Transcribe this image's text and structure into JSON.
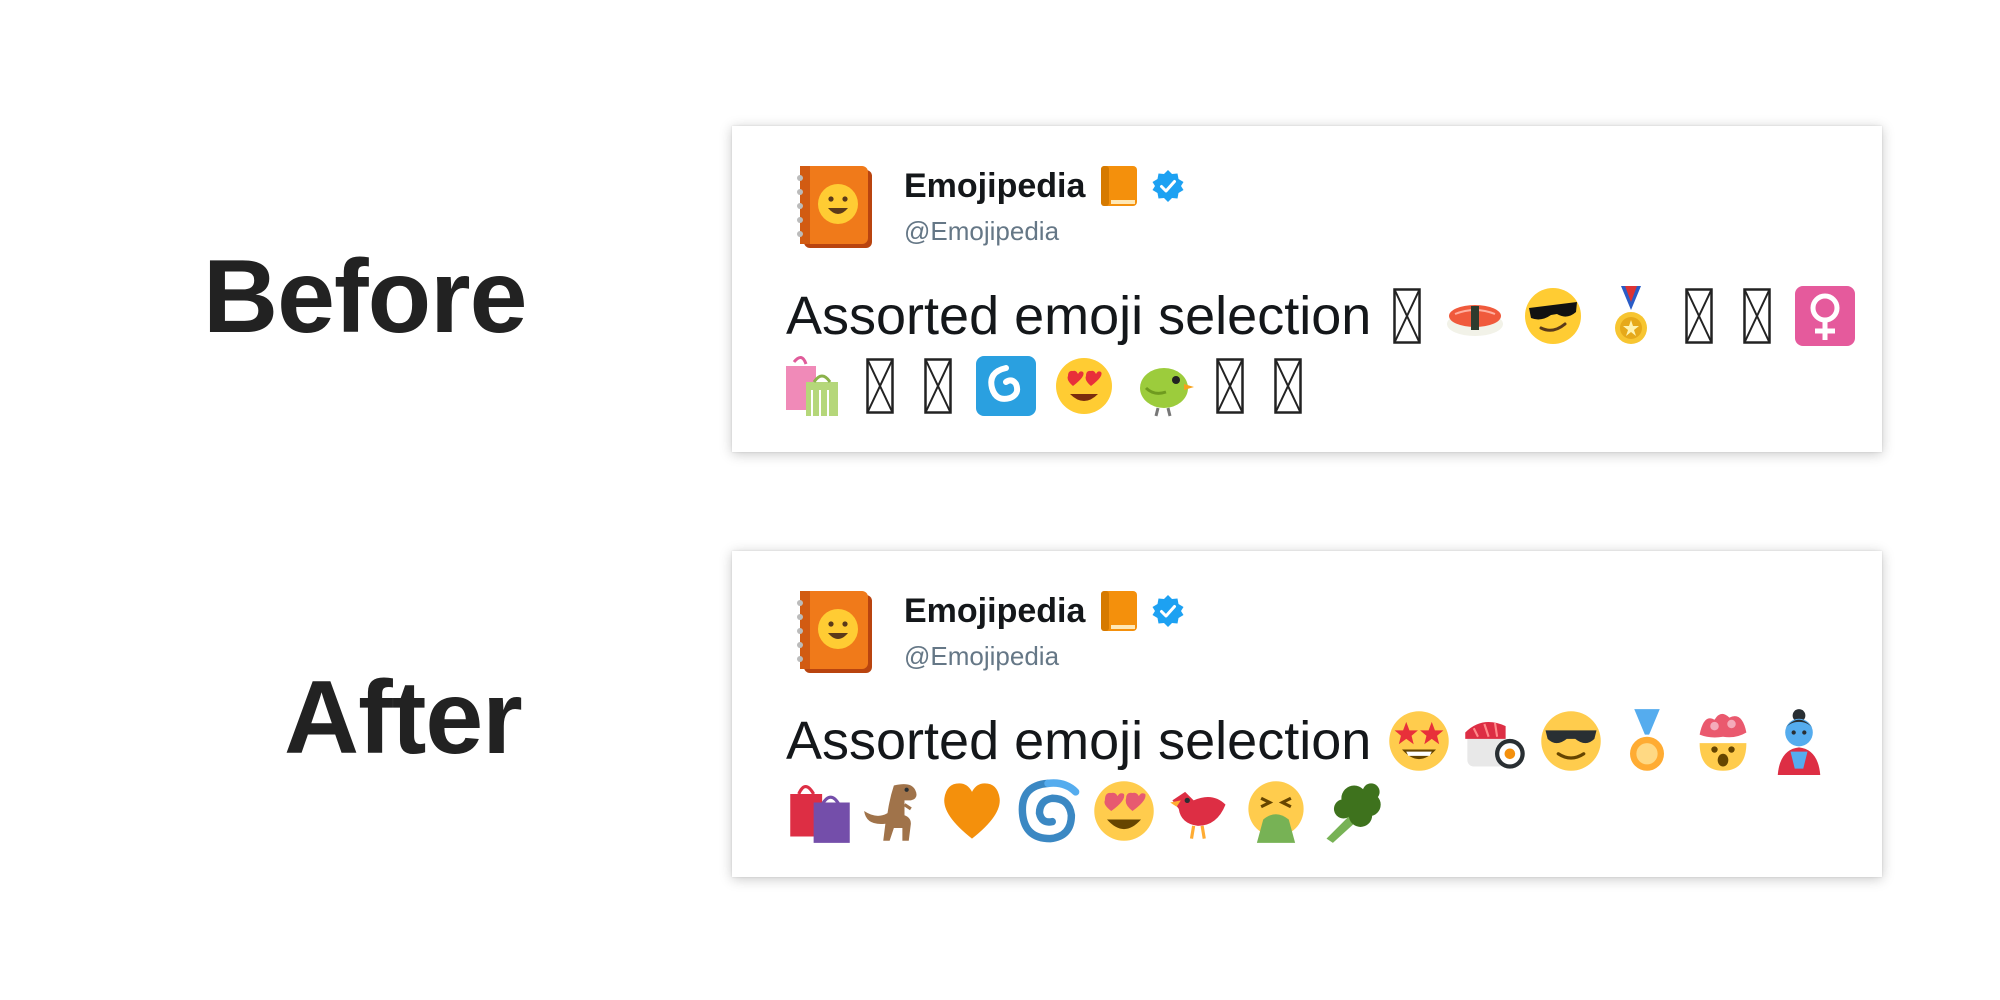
{
  "labels": {
    "before": "Before",
    "after": "After"
  },
  "tweet": {
    "display_name": "Emojipedia",
    "handle": "@Emojipedia",
    "text": "Assorted emoji selection"
  },
  "before": {
    "line1": [
      "missing-glyph",
      "sushi",
      "smiling-face-with-sunglasses",
      "sports-medal",
      "missing-glyph",
      "missing-glyph",
      "female-sign"
    ],
    "line2": [
      "shopping-bags",
      "missing-glyph",
      "missing-glyph",
      "cyclone",
      "smiling-face-with-heart-eyes",
      "bird",
      "missing-glyph",
      "missing-glyph"
    ]
  },
  "after": {
    "line1": [
      "star-struck",
      "sushi",
      "smiling-face-with-sunglasses",
      "sports-medal",
      "exploding-head",
      "genie"
    ],
    "line2": [
      "shopping-bags",
      "t-rex",
      "orange-heart",
      "cyclone",
      "smiling-face-with-heart-eyes",
      "bird",
      "face-vomiting",
      "broccoli"
    ]
  },
  "colors": {
    "text": "#14171a",
    "handle": "#657786",
    "verified": "#1da1f2",
    "label": "#222222"
  }
}
